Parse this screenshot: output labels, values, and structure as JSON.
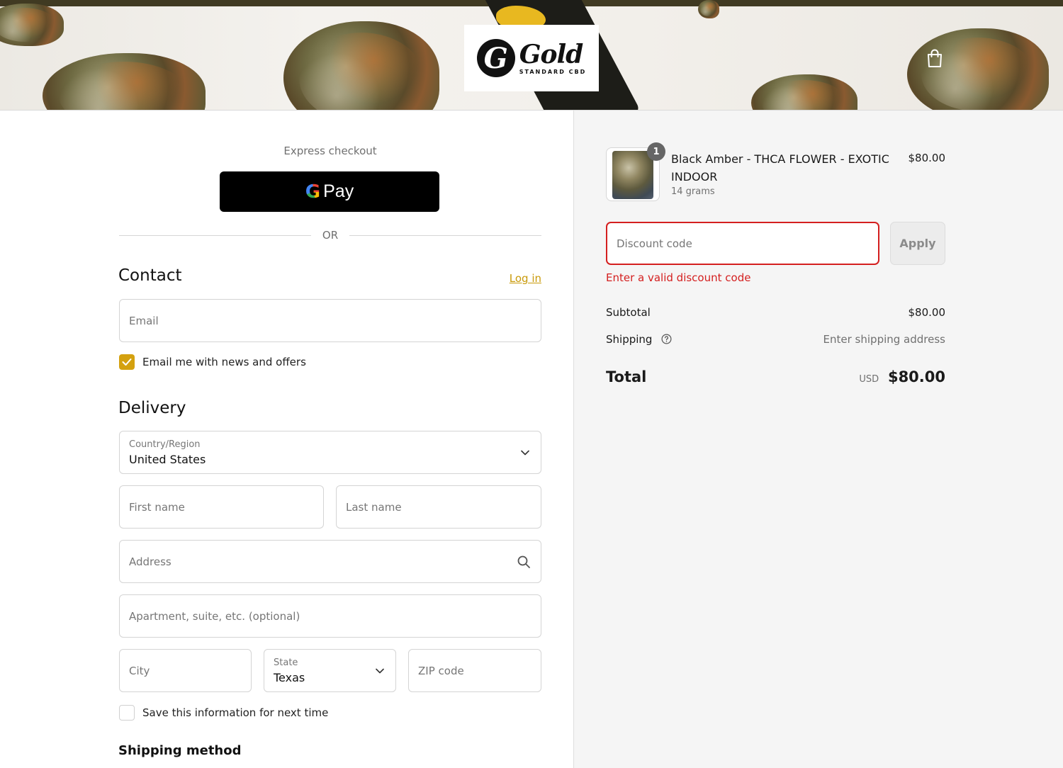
{
  "header": {
    "logo_mark": "G",
    "logo_word": "Gold",
    "logo_sub": "STANDARD CBD",
    "cart_icon": "shopping-bag-icon"
  },
  "express": {
    "label": "Express checkout",
    "gpay_g": "G",
    "gpay_label": "Pay",
    "or_label": "OR"
  },
  "contact": {
    "title": "Contact",
    "login_label": "Log in",
    "email_placeholder": "Email",
    "news_label": "Email me with news and offers",
    "news_checked": true
  },
  "delivery": {
    "title": "Delivery",
    "country_label": "Country/Region",
    "country_value": "United States",
    "first_name_placeholder": "First name",
    "last_name_placeholder": "Last name",
    "address_placeholder": "Address",
    "apartment_placeholder": "Apartment, suite, etc. (optional)",
    "city_placeholder": "City",
    "state_label": "State",
    "state_value": "Texas",
    "zip_placeholder": "ZIP code",
    "save_label": "Save this information for next time",
    "save_checked": false,
    "shipping_method_title": "Shipping method"
  },
  "summary": {
    "item": {
      "quantity": "1",
      "name": "Black Amber - THCA FLOWER - EXOTIC INDOOR",
      "variant": "14 grams",
      "price": "$80.00"
    },
    "discount_placeholder": "Discount code",
    "apply_label": "Apply",
    "discount_error": "Enter a valid discount code",
    "subtotal_label": "Subtotal",
    "subtotal_value": "$80.00",
    "shipping_label": "Shipping",
    "shipping_value": "Enter shipping address",
    "total_label": "Total",
    "total_currency": "USD",
    "total_value": "$80.00"
  },
  "colors": {
    "accent": "#d4a10f",
    "link": "#c99a0a",
    "error": "#d41f1f",
    "summary_bg": "#f5f5f5"
  }
}
